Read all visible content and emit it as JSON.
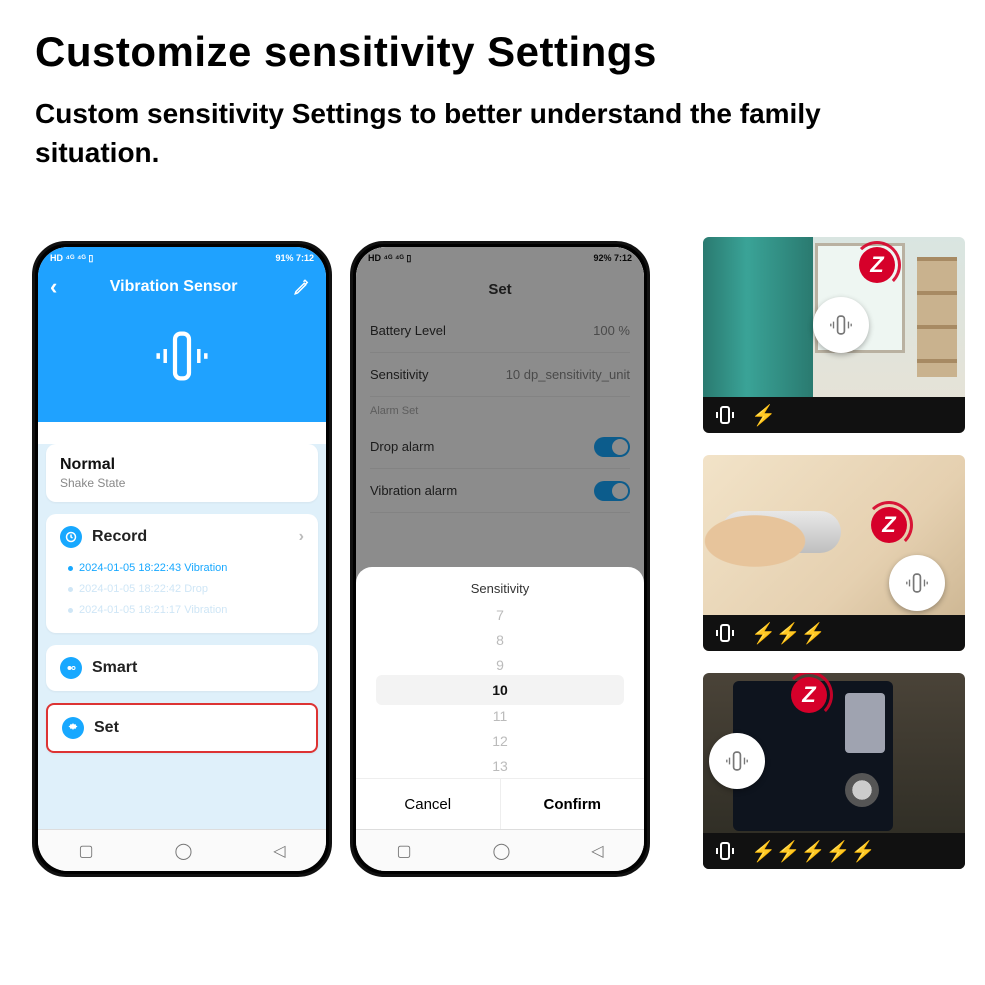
{
  "hero": {
    "title": "Customize sensitivity Settings",
    "subtitle": "Custom sensitivity Settings to better understand the family situation."
  },
  "phone1": {
    "status_left": "HD ⁴ᴳ ⁴ᴳ ▯",
    "status_right": "91%  7:12",
    "title": "Vibration Sensor",
    "state_value": "Normal",
    "state_label": "Shake State",
    "record_label": "Record",
    "records": [
      {
        "text": "2024-01-05 18:22:43 Vibration",
        "fade": false
      },
      {
        "text": "2024-01-05 18:22:42 Drop",
        "fade": true
      },
      {
        "text": "2024-01-05 18:21:17 Vibration",
        "fade": true
      }
    ],
    "smart_label": "Smart",
    "set_label": "Set"
  },
  "phone2": {
    "status_left": "HD ⁴ᴳ ⁴ᴳ ▯",
    "status_right": "92%  7:12",
    "page_title": "Set",
    "rows": {
      "battery_label": "Battery Level",
      "battery_value": "100 %",
      "sensitivity_label": "Sensitivity",
      "sensitivity_value": "10 dp_sensitivity_unit",
      "section": "Alarm Set",
      "drop_label": "Drop alarm",
      "vib_label": "Vibration alarm"
    },
    "sheet": {
      "title": "Sensitivity",
      "options": [
        "7",
        "8",
        "9",
        "10",
        "11",
        "12",
        "13"
      ],
      "selected": "10",
      "cancel": "Cancel",
      "confirm": "Confirm"
    }
  },
  "tiles": {
    "bolt_counts": [
      1,
      3,
      5
    ]
  }
}
